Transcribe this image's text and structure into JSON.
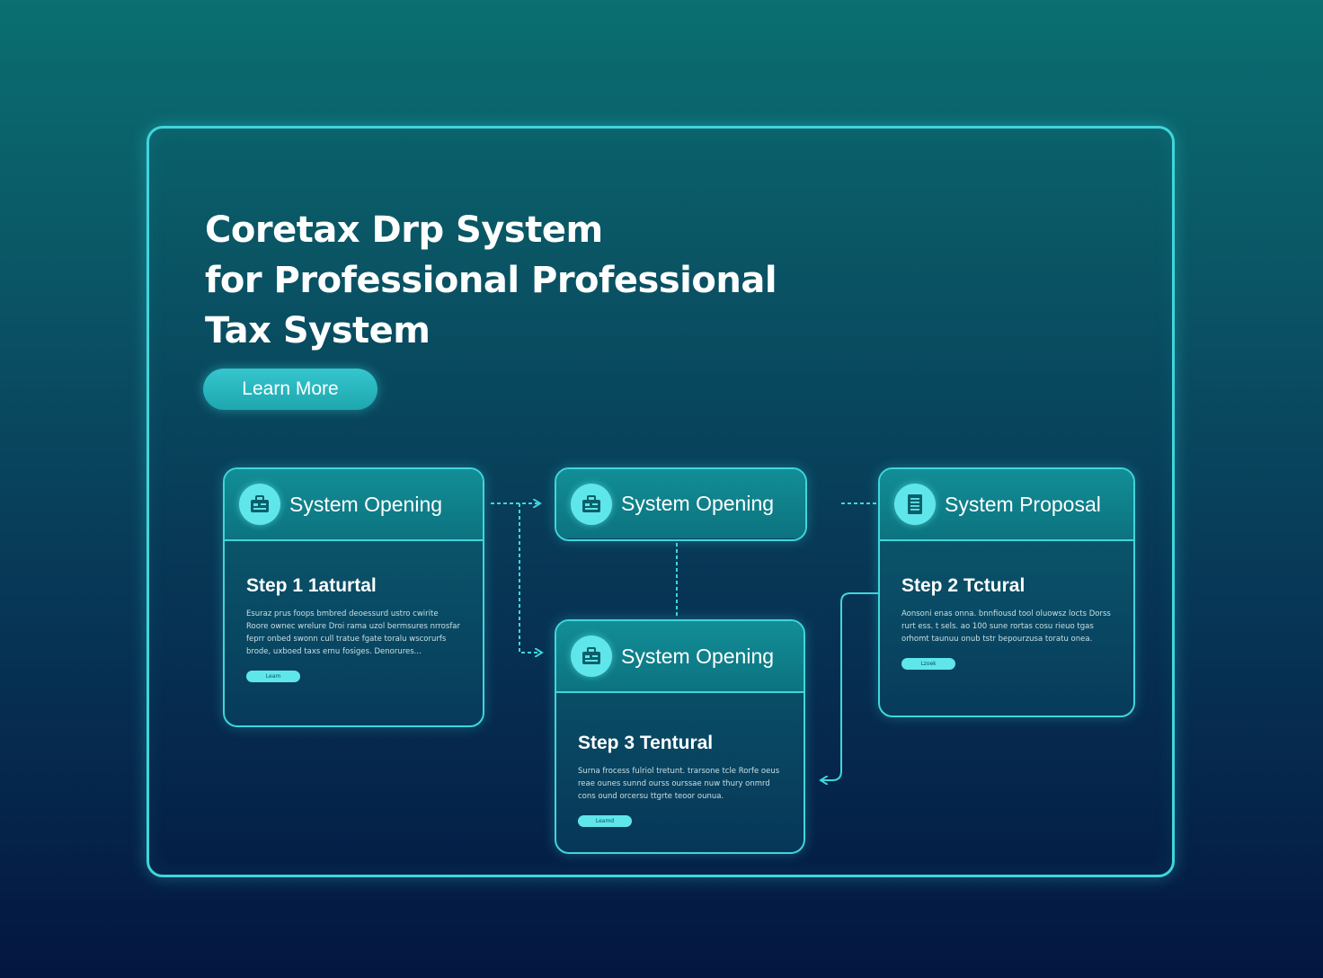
{
  "hero": {
    "title_line1": "Coretax Drp System",
    "title_line2": "for Professional Professional",
    "title_line3": "Tax System",
    "cta_label": "Learn More"
  },
  "cards": {
    "card1": {
      "title": "System Opening",
      "icon": "briefcase-icon",
      "step_title": "Step 1 1aturtal",
      "body": "Esuraz prus foops bmbred deoessurd ustro cwirite Roore ownec wrelure Droi rama uzol bermsures nrrosfar feprr onbed swonn cull tratue fgate toralu wscorurfs brode, uxboed taxs ernu fosiges. Denorures...",
      "button_label": "Leam"
    },
    "card2": {
      "title": "System Opening",
      "icon": "briefcase-icon"
    },
    "card3": {
      "title": "System Opening",
      "icon": "briefcase-icon",
      "step_title": "Step 3 Tentural",
      "body": "Surna frocess fulriol tretunt. trarsone tcle Rorfe oeus reae ounes sunnd ourss ourssae nuw thury onmrd cons ound orcersu ttgrte teoor ounua.",
      "button_label": "Leamd"
    },
    "card4": {
      "title": "System Proposal",
      "icon": "document-icon",
      "step_title": "Step 2 Tctural",
      "body": "Aonsoni enas onna. bnnfiousd tool oluowsz locts Dorss rurt ess. t sels. ao 100 sune rortas cosu rieuo tgas orhomt taunuu onub tstr bepourzusa toratu onea.",
      "button_label": "Lzoek"
    }
  },
  "colors": {
    "accent": "#3fd6dc",
    "icon_bg": "#5fe6ea",
    "button": "#1ea6ae"
  }
}
